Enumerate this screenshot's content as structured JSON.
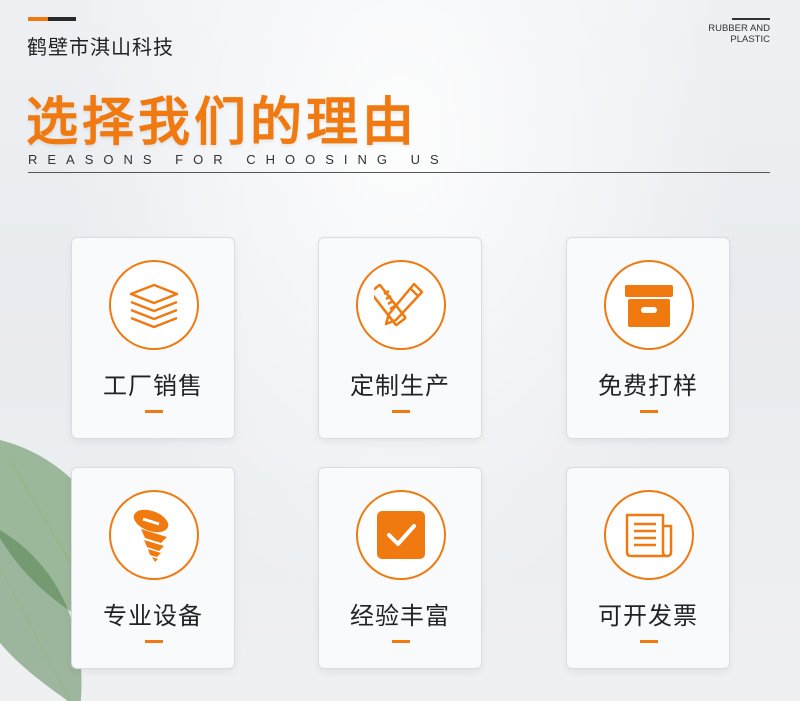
{
  "header": {
    "company": "鹤壁市淇山科技",
    "brand_line1": "RUBBER AND",
    "brand_line2": "PLASTIC",
    "headline": "选择我们的理由",
    "subtitle": "REASONS FOR CHOOSING US"
  },
  "colors": {
    "accent": "#f07a10",
    "text": "#222222"
  },
  "cards": [
    {
      "label": "工厂销售",
      "icon": "stacked-layers-icon"
    },
    {
      "label": "定制生产",
      "icon": "ruler-pencil-icon"
    },
    {
      "label": "免费打样",
      "icon": "storage-box-icon"
    },
    {
      "label": "专业设备",
      "icon": "screw-icon"
    },
    {
      "label": "经验丰富",
      "icon": "checkbox-icon"
    },
    {
      "label": "可开发票",
      "icon": "invoice-icon"
    }
  ]
}
